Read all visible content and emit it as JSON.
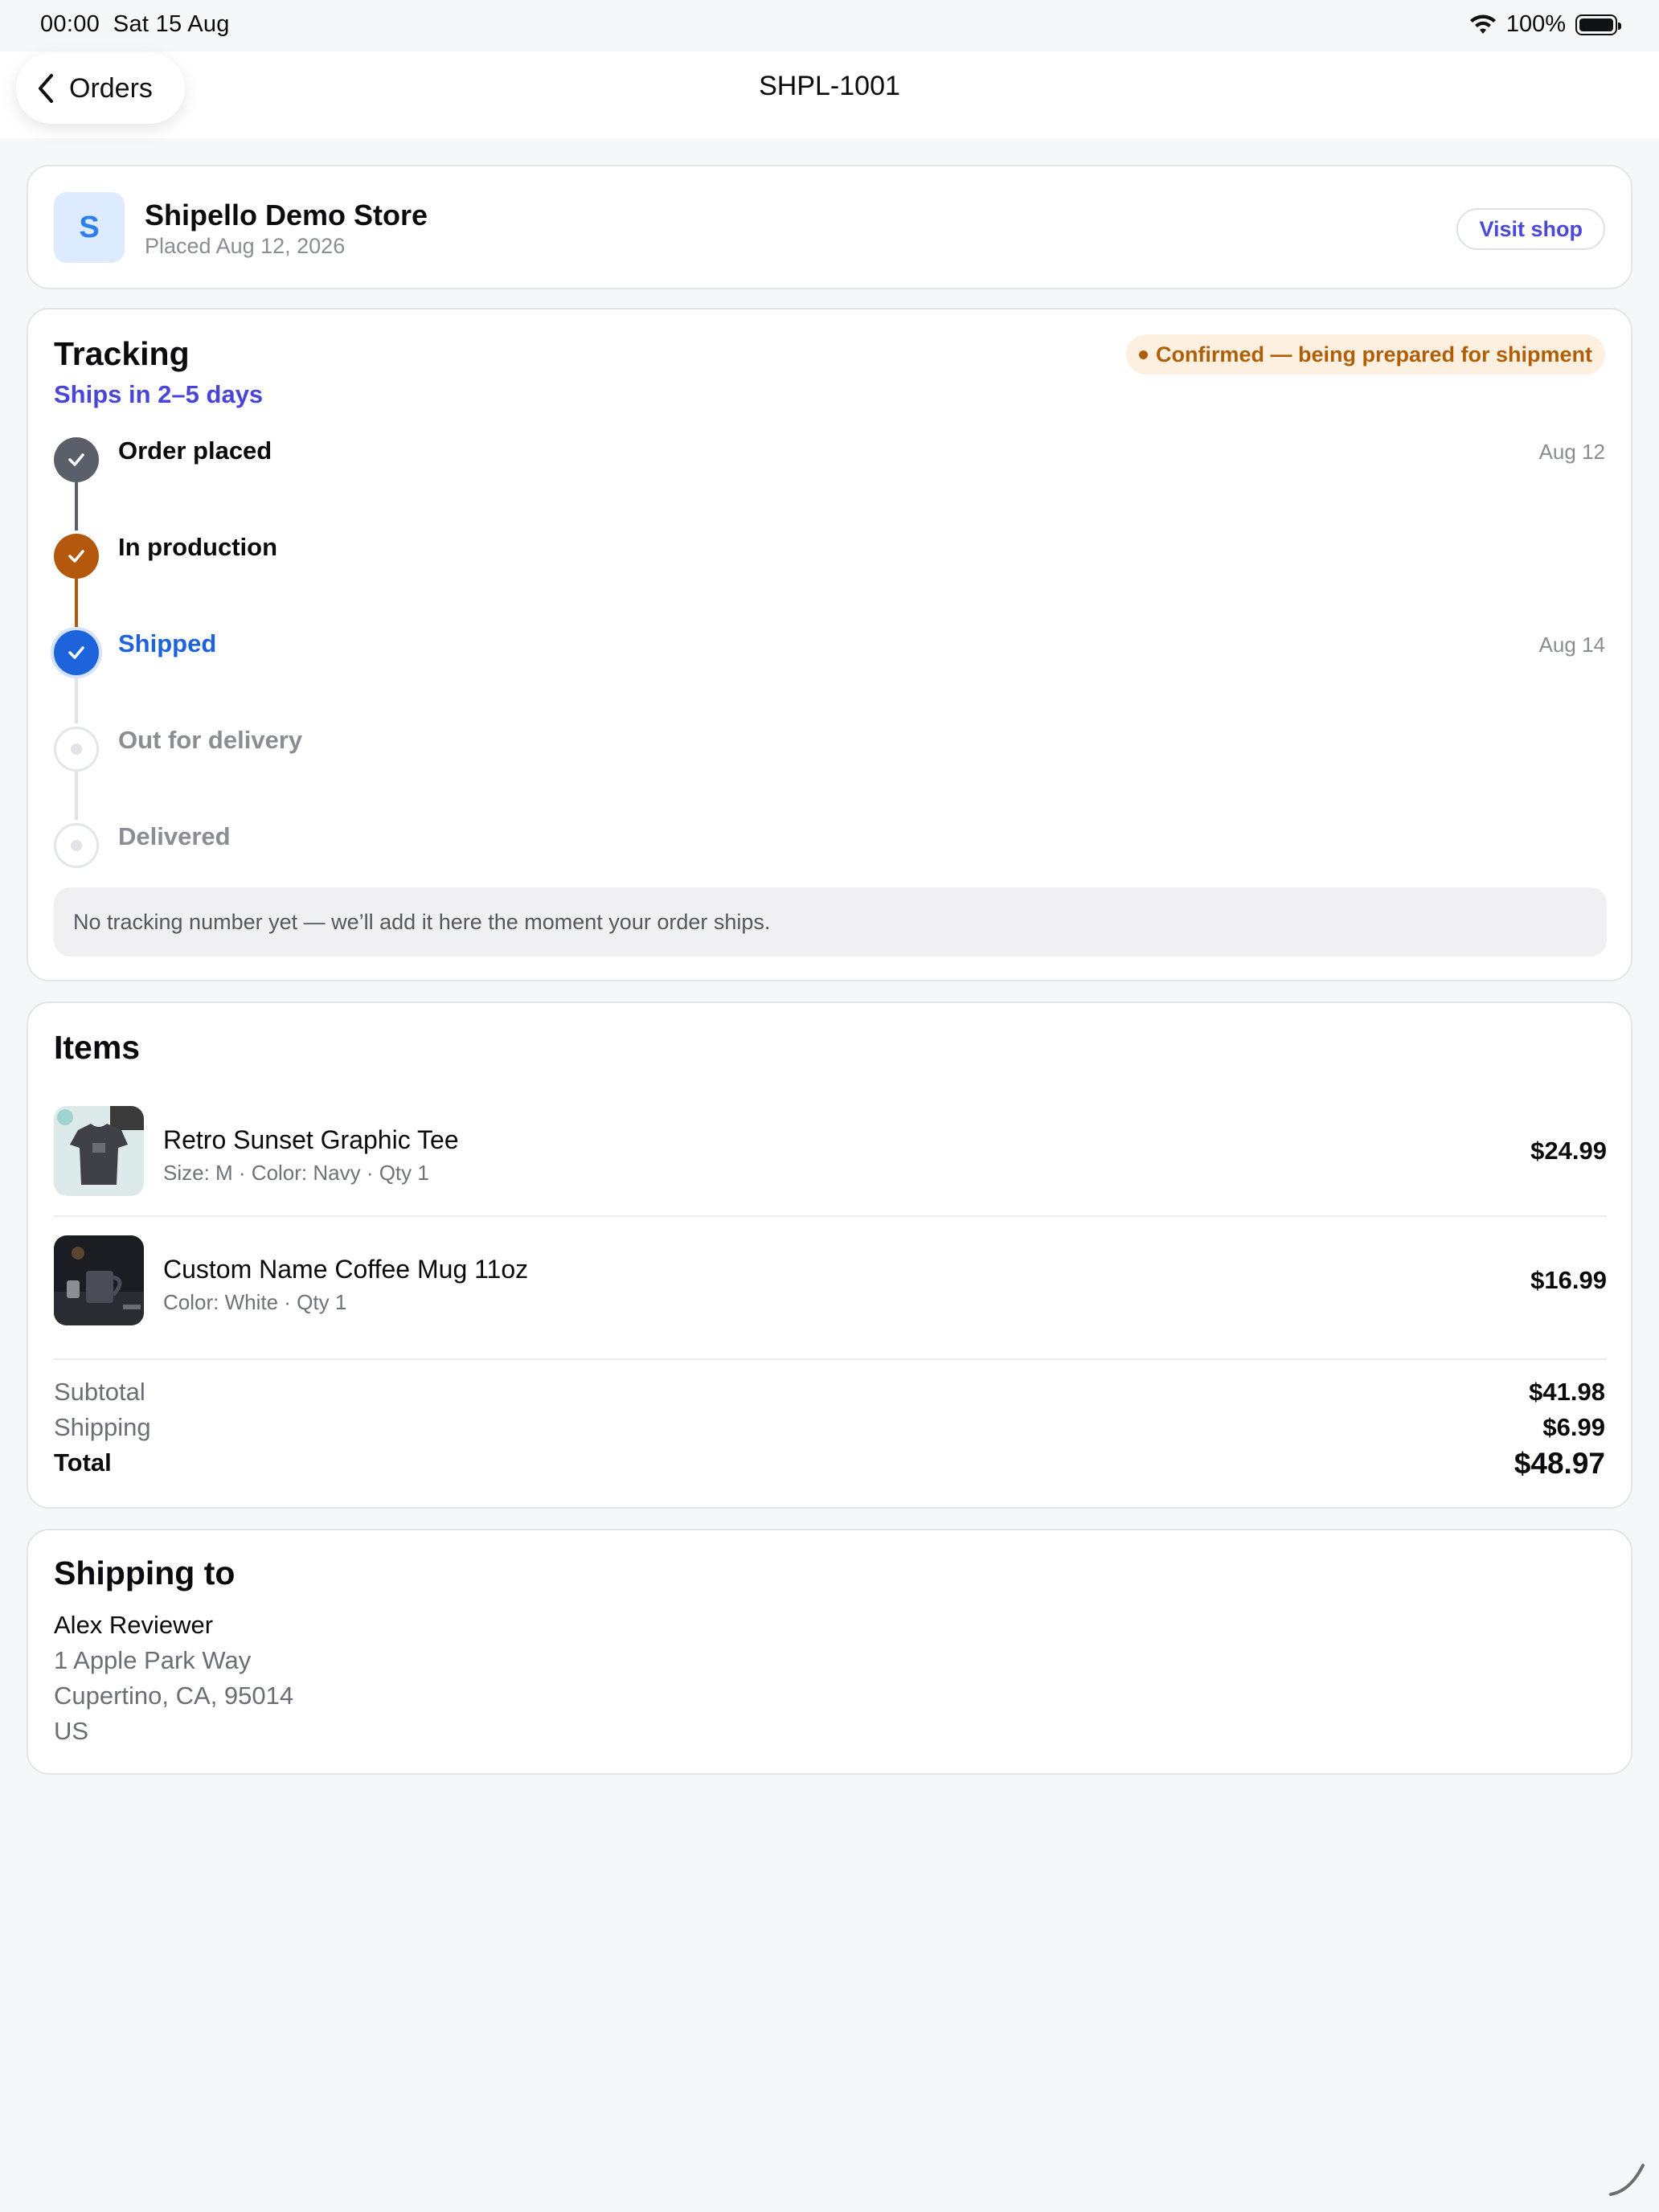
{
  "status_bar": {
    "time": "00:00",
    "date": "Sat 15 Aug",
    "battery": "100%"
  },
  "nav": {
    "back_label": "Orders",
    "title": "SHPL-1001"
  },
  "store": {
    "initial": "S",
    "name": "Shipello Demo Store",
    "placed": "Placed Aug 12, 2026",
    "visit_label": "Visit shop"
  },
  "tracking": {
    "title": "Tracking",
    "ships_in": "Ships in 2–5 days",
    "status": "Confirmed — being prepared for shipment",
    "steps": [
      {
        "label": "Order placed",
        "date": "Aug 12",
        "state": "done"
      },
      {
        "label": "In production",
        "date": "",
        "state": "done"
      },
      {
        "label": "Shipped",
        "date": "Aug 14",
        "state": "current"
      },
      {
        "label": "Out for delivery",
        "date": "",
        "state": "pending"
      },
      {
        "label": "Delivered",
        "date": "",
        "state": "pending"
      }
    ],
    "note": "No tracking number yet — we’ll add it here the moment your order ships.",
    "colors": {
      "done": "#5b5f69",
      "production": "#b3580c",
      "current": "#1c63dc",
      "pending": "#e5e6ea"
    }
  },
  "items": {
    "title": "Items",
    "list": [
      {
        "name": "Retro Sunset Graphic Tee",
        "meta": "Size: M · Color: Navy · Qty 1",
        "price": "$24.99"
      },
      {
        "name": "Custom Name Coffee Mug 11oz",
        "meta": "Color: White · Qty 1",
        "price": "$16.99"
      }
    ],
    "subtotal_label": "Subtotal",
    "subtotal": "$41.98",
    "shipping_label": "Shipping",
    "shipping": "$6.99",
    "total_label": "Total",
    "total": "$48.97"
  },
  "shipping_to": {
    "title": "Shipping to",
    "name": "Alex Reviewer",
    "line1": "1 Apple Park Way",
    "line2": "Cupertino, CA, 95014",
    "country": "US"
  }
}
